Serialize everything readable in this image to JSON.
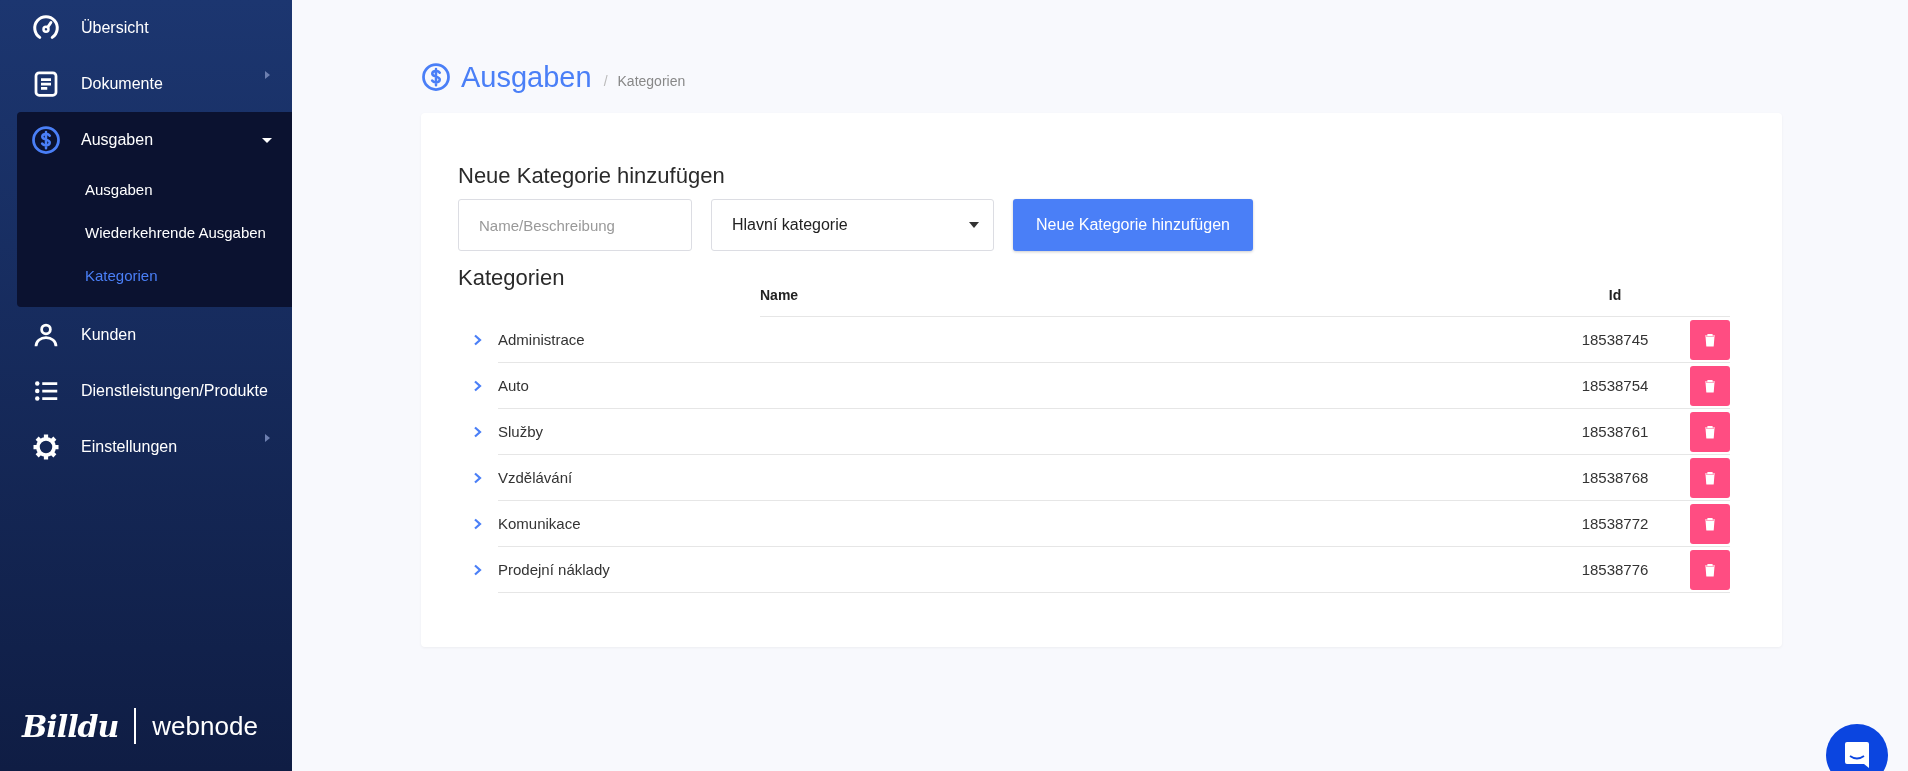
{
  "sidebar": {
    "items": [
      {
        "label": "Übersicht",
        "has_submenu": false
      },
      {
        "label": "Dokumente",
        "has_submenu": true,
        "expanded": false
      },
      {
        "label": "Ausgaben",
        "has_submenu": true,
        "expanded": true,
        "children": [
          {
            "label": "Ausgaben",
            "selected": false
          },
          {
            "label": "Wiederkehrende Ausgaben",
            "selected": false
          },
          {
            "label": "Kategorien",
            "selected": true
          }
        ]
      },
      {
        "label": "Kunden",
        "has_submenu": false
      },
      {
        "label": "Dienstleistungen/Produkte",
        "has_submenu": false
      },
      {
        "label": "Einstellungen",
        "has_submenu": true,
        "expanded": false
      }
    ],
    "logo": {
      "brand": "Billdu",
      "partner": "webnode"
    }
  },
  "header": {
    "title": "Ausgaben",
    "separator": "/",
    "breadcrumb": "Kategorien"
  },
  "form": {
    "heading": "Neue Kategorie hinzufügen",
    "name_field": {
      "placeholder": "Name/Beschreibung"
    },
    "parent_select": {
      "value": "Hlavní kategorie"
    },
    "submit": "Neue Kategorie hinzufügen"
  },
  "table": {
    "heading": "Kategorien",
    "columns": [
      "Name",
      "Id"
    ],
    "rows": [
      {
        "name": "Administrace",
        "id": "18538745"
      },
      {
        "name": "Auto",
        "id": "18538754"
      },
      {
        "name": "Služby",
        "id": "18538761"
      },
      {
        "name": "Vzdělávání",
        "id": "18538768"
      },
      {
        "name": "Komunikace",
        "id": "18538772"
      },
      {
        "name": "Prodejní náklady",
        "id": "18538776"
      }
    ]
  }
}
